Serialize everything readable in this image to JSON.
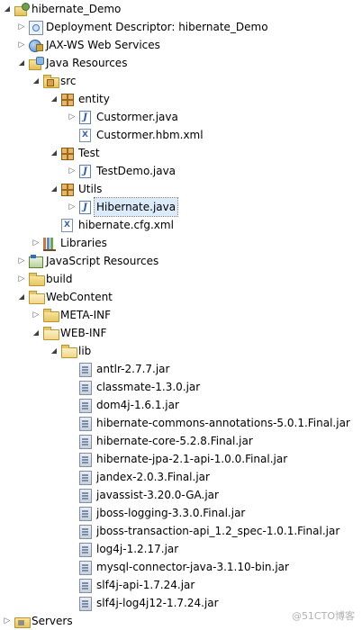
{
  "tree": [
    {
      "label": "hibernate_Demo",
      "depth": 0,
      "toggle": "expanded",
      "icon": "project-icon"
    },
    {
      "label": "Deployment Descriptor: hibernate_Demo",
      "depth": 1,
      "toggle": "collapsed",
      "icon": "deployment-descriptor-icon"
    },
    {
      "label": "JAX-WS Web Services",
      "depth": 1,
      "toggle": "collapsed",
      "icon": "web-services-icon"
    },
    {
      "label": "Java Resources",
      "depth": 1,
      "toggle": "expanded",
      "icon": "java-resources-icon"
    },
    {
      "label": "src",
      "depth": 2,
      "toggle": "expanded",
      "icon": "source-folder-icon"
    },
    {
      "label": "entity",
      "depth": 3,
      "toggle": "expanded",
      "icon": "package-icon"
    },
    {
      "label": "Custormer.java",
      "depth": 4,
      "toggle": "collapsed",
      "icon": "java-file-icon"
    },
    {
      "label": "Custormer.hbm.xml",
      "depth": 4,
      "toggle": "none",
      "icon": "xml-file-icon"
    },
    {
      "label": "Test",
      "depth": 3,
      "toggle": "expanded",
      "icon": "package-icon"
    },
    {
      "label": "TestDemo.java",
      "depth": 4,
      "toggle": "collapsed",
      "icon": "java-file-icon"
    },
    {
      "label": "Utils",
      "depth": 3,
      "toggle": "expanded",
      "icon": "package-icon"
    },
    {
      "label": "Hibernate.java",
      "depth": 4,
      "toggle": "collapsed",
      "icon": "java-file-icon",
      "selected": true
    },
    {
      "label": "hibernate.cfg.xml",
      "depth": 3,
      "toggle": "none",
      "icon": "xml-file-icon"
    },
    {
      "label": "Libraries",
      "depth": 2,
      "toggle": "collapsed",
      "icon": "libraries-icon"
    },
    {
      "label": "JavaScript Resources",
      "depth": 1,
      "toggle": "collapsed",
      "icon": "javascript-resources-icon"
    },
    {
      "label": "build",
      "depth": 1,
      "toggle": "collapsed",
      "icon": "folder-icon"
    },
    {
      "label": "WebContent",
      "depth": 1,
      "toggle": "expanded",
      "icon": "folder-open-icon"
    },
    {
      "label": "META-INF",
      "depth": 2,
      "toggle": "collapsed",
      "icon": "folder-icon"
    },
    {
      "label": "WEB-INF",
      "depth": 2,
      "toggle": "expanded",
      "icon": "folder-open-icon"
    },
    {
      "label": "lib",
      "depth": 3,
      "toggle": "expanded",
      "icon": "folder-open-icon"
    },
    {
      "label": "antlr-2.7.7.jar",
      "depth": 4,
      "toggle": "none",
      "icon": "jar-icon"
    },
    {
      "label": "classmate-1.3.0.jar",
      "depth": 4,
      "toggle": "none",
      "icon": "jar-icon"
    },
    {
      "label": "dom4j-1.6.1.jar",
      "depth": 4,
      "toggle": "none",
      "icon": "jar-icon"
    },
    {
      "label": "hibernate-commons-annotations-5.0.1.Final.jar",
      "depth": 4,
      "toggle": "none",
      "icon": "jar-icon"
    },
    {
      "label": "hibernate-core-5.2.8.Final.jar",
      "depth": 4,
      "toggle": "none",
      "icon": "jar-icon"
    },
    {
      "label": "hibernate-jpa-2.1-api-1.0.0.Final.jar",
      "depth": 4,
      "toggle": "none",
      "icon": "jar-icon"
    },
    {
      "label": "jandex-2.0.3.Final.jar",
      "depth": 4,
      "toggle": "none",
      "icon": "jar-icon"
    },
    {
      "label": "javassist-3.20.0-GA.jar",
      "depth": 4,
      "toggle": "none",
      "icon": "jar-icon"
    },
    {
      "label": "jboss-logging-3.3.0.Final.jar",
      "depth": 4,
      "toggle": "none",
      "icon": "jar-icon"
    },
    {
      "label": "jboss-transaction-api_1.2_spec-1.0.1.Final.jar",
      "depth": 4,
      "toggle": "none",
      "icon": "jar-icon"
    },
    {
      "label": "log4j-1.2.17.jar",
      "depth": 4,
      "toggle": "none",
      "icon": "jar-icon"
    },
    {
      "label": "mysql-connector-java-3.1.10-bin.jar",
      "depth": 4,
      "toggle": "none",
      "icon": "jar-icon"
    },
    {
      "label": "slf4j-api-1.7.24.jar",
      "depth": 4,
      "toggle": "none",
      "icon": "jar-icon"
    },
    {
      "label": "slf4j-log4j12-1.7.24.jar",
      "depth": 4,
      "toggle": "none",
      "icon": "jar-icon"
    },
    {
      "label": "Servers",
      "depth": 0,
      "toggle": "collapsed",
      "icon": "servers-folder-icon"
    }
  ],
  "watermark": "@51CTO博客"
}
